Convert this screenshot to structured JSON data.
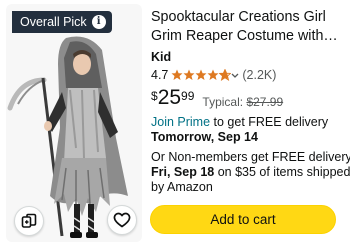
{
  "badge": {
    "label": "Overall Pick",
    "icon": "info-icon"
  },
  "product": {
    "title": "Spooktacular Creations Girl Grim Reaper Costume with…",
    "brand": "Kid",
    "rating": "4.7",
    "stars": 4.7,
    "review_count": "(2.2K)"
  },
  "price": {
    "currency": "$",
    "dollars": "25",
    "cents": "99",
    "typical_label": "Typical:",
    "typical_price": "$27.99"
  },
  "delivery": {
    "prime_link": "Join Prime",
    "prime_text": " to get FREE delivery",
    "prime_date": "Tomorrow, Sep 14",
    "nonmember_text": "Or Non-members get FREE delivery",
    "nonmember_date": "Fri, Sep 18",
    "nonmember_tail": " on $35 of items shipped",
    "shipped_by": "by Amazon"
  },
  "actions": {
    "add_to_cart": "Add to cart",
    "compare_icon": "compare-icon",
    "wishlist_icon": "heart-icon"
  },
  "colors": {
    "badge_bg": "#232f3e",
    "star": "#de7921",
    "link": "#007185",
    "button": "#ffd814"
  }
}
